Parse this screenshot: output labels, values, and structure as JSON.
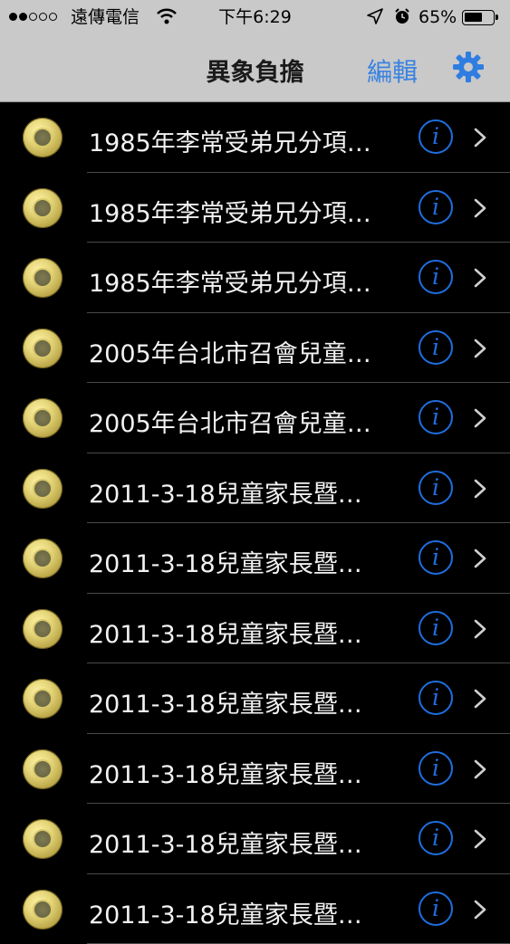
{
  "status_bar": {
    "signal_dots_filled": 2,
    "signal_dots_total": 5,
    "carrier": "遠傳電信",
    "time": "下午6:29",
    "battery_percent": "65%",
    "battery_level": 0.65,
    "wifi_icon": "wifi-icon",
    "location_icon": "location-arrow-icon",
    "alarm_icon": "alarm-clock-icon"
  },
  "nav": {
    "title": "異象負擔",
    "edit_label": "編輯",
    "settings_icon": "gear-icon",
    "accent_color": "#3a83e0"
  },
  "list": {
    "items": [
      {
        "title": "1985年李常受弟兄分項…"
      },
      {
        "title": "1985年李常受弟兄分項…"
      },
      {
        "title": "1985年李常受弟兄分項…"
      },
      {
        "title": "2005年台北市召會兒童…"
      },
      {
        "title": "2005年台北市召會兒童…"
      },
      {
        "title": "2011-3-18兒童家長暨…"
      },
      {
        "title": "2011-3-18兒童家長暨…"
      },
      {
        "title": "2011-3-18兒童家長暨…"
      },
      {
        "title": "2011-3-18兒童家長暨…"
      },
      {
        "title": "2011-3-18兒童家長暨…"
      },
      {
        "title": "2011-3-18兒童家長暨…"
      },
      {
        "title": "2011-3-18兒童家長暨…"
      }
    ],
    "item_icon": "gold-coin-icon",
    "info_icon": "info-icon",
    "disclosure_icon": "chevron-right-icon",
    "info_color": "#1f6ee0"
  }
}
